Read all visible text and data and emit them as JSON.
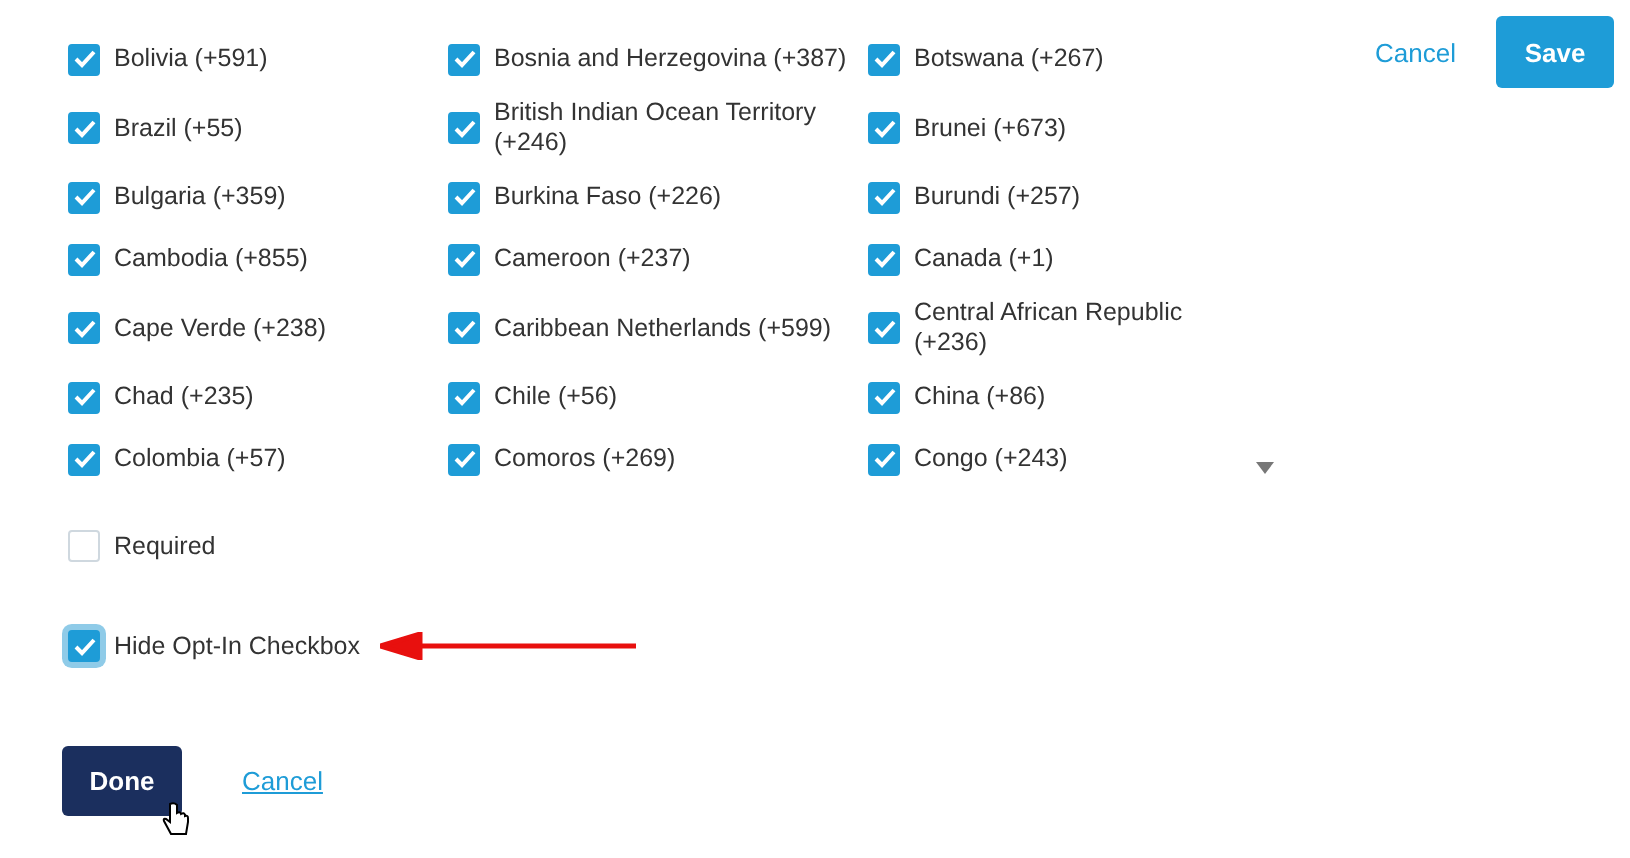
{
  "country_rows": [
    {
      "cells": [
        {
          "label": "Bolivia (+591)",
          "checked": true
        },
        {
          "label": "Bosnia and Herzegovina (+387)",
          "checked": true
        },
        {
          "label": "Botswana (+267)",
          "checked": true
        }
      ]
    },
    {
      "cells": [
        {
          "label": "Brazil (+55)",
          "checked": true
        },
        {
          "label": "British Indian Ocean Territory (+246)",
          "checked": true
        },
        {
          "label": "Brunei (+673)",
          "checked": true
        }
      ]
    },
    {
      "cells": [
        {
          "label": "Bulgaria (+359)",
          "checked": true
        },
        {
          "label": "Burkina Faso (+226)",
          "checked": true
        },
        {
          "label": "Burundi (+257)",
          "checked": true
        }
      ]
    },
    {
      "cells": [
        {
          "label": "Cambodia (+855)",
          "checked": true
        },
        {
          "label": "Cameroon (+237)",
          "checked": true
        },
        {
          "label": "Canada (+1)",
          "checked": true
        }
      ]
    },
    {
      "cells": [
        {
          "label": "Cape Verde (+238)",
          "checked": true
        },
        {
          "label": "Caribbean Netherlands (+599)",
          "checked": true
        },
        {
          "label": "Central African Republic (+236)",
          "checked": true
        }
      ]
    },
    {
      "cells": [
        {
          "label": "Chad (+235)",
          "checked": true
        },
        {
          "label": "Chile (+56)",
          "checked": true
        },
        {
          "label": "China (+86)",
          "checked": true
        }
      ]
    },
    {
      "cells": [
        {
          "label": "Colombia (+57)",
          "checked": true
        },
        {
          "label": "Comoros (+269)",
          "checked": true
        },
        {
          "label": "Congo (+243)",
          "checked": true
        }
      ]
    }
  ],
  "top_actions": {
    "cancel": "Cancel",
    "save": "Save"
  },
  "options": [
    {
      "label": "Required",
      "checked": false,
      "focused": false
    },
    {
      "label": "Hide Opt-In Checkbox",
      "checked": true,
      "focused": true
    }
  ],
  "bottom_actions": {
    "done": "Done",
    "cancel": "Cancel"
  }
}
